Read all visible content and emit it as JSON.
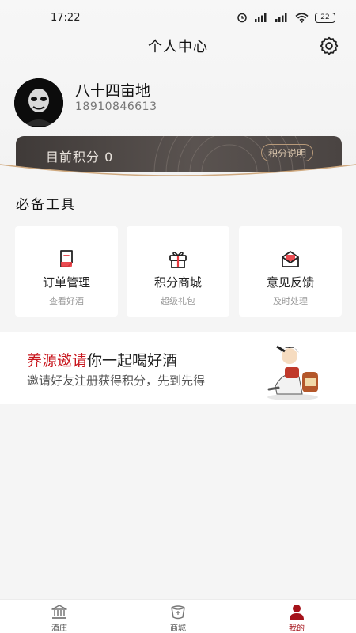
{
  "status_bar": {
    "time": "17:22",
    "battery": "22"
  },
  "header": {
    "title": "个人中心"
  },
  "profile": {
    "name": "八十四亩地",
    "phone": "18910846613"
  },
  "points": {
    "label": "目前积分",
    "value": "0",
    "explain_button": "积分说明"
  },
  "tools": {
    "title": "必备工具",
    "items": [
      {
        "title": "订单管理",
        "subtitle": "查看好酒",
        "icon": "order-icon"
      },
      {
        "title": "积分商城",
        "subtitle": "超级礼包",
        "icon": "gift-icon"
      },
      {
        "title": "意见反馈",
        "subtitle": "及时处理",
        "icon": "feedback-icon"
      }
    ]
  },
  "invite": {
    "title_highlight": "养源邀请",
    "title_rest": "你一起喝好酒",
    "subtitle": "邀请好友注册获得积分，先到先得"
  },
  "tabbar": {
    "items": [
      {
        "label": "酒庄",
        "icon": "winery-icon",
        "active": false
      },
      {
        "label": "商城",
        "icon": "mall-icon",
        "active": false
      },
      {
        "label": "我的",
        "icon": "profile-icon",
        "active": true
      }
    ]
  },
  "colors": {
    "accent": "#a5121a",
    "highlight_red": "#c8161d",
    "card_dark": "#4a4442"
  }
}
